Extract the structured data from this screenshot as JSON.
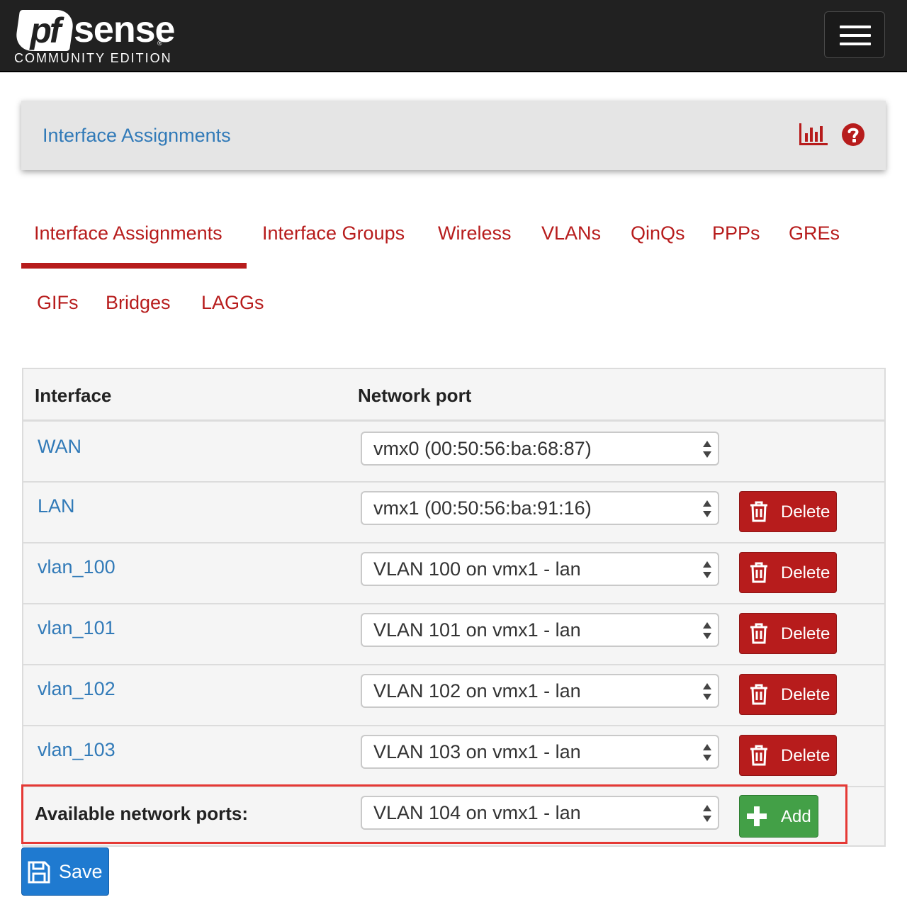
{
  "navbar": {
    "logo_pf": "pf",
    "logo_sense": "sense",
    "logo_reg": "®",
    "logo_edition": "COMMUNITY EDITION"
  },
  "header": {
    "title": "Interface Assignments"
  },
  "tabs": [
    {
      "label": "Interface Assignments",
      "active": true
    },
    {
      "label": "Interface Groups"
    },
    {
      "label": "Wireless"
    },
    {
      "label": "VLANs"
    },
    {
      "label": "QinQs"
    },
    {
      "label": "PPPs"
    },
    {
      "label": "GREs"
    },
    {
      "label": "GIFs"
    },
    {
      "label": "Bridges"
    },
    {
      "label": "LAGGs"
    }
  ],
  "table": {
    "headers": {
      "interface": "Interface",
      "network_port": "Network port"
    },
    "rows": [
      {
        "interface": "WAN",
        "port": "vmx0 (00:50:56:ba:68:87)"
      },
      {
        "interface": "LAN",
        "port": "vmx1 (00:50:56:ba:91:16)",
        "action": "Delete"
      },
      {
        "interface": "vlan_100",
        "port": "VLAN 100 on vmx1 - lan",
        "action": "Delete"
      },
      {
        "interface": "vlan_101",
        "port": "VLAN 101 on vmx1 - lan",
        "action": "Delete"
      },
      {
        "interface": "vlan_102",
        "port": "VLAN 102 on vmx1 - lan",
        "action": "Delete"
      },
      {
        "interface": "vlan_103",
        "port": "VLAN 103 on vmx1 - lan",
        "action": "Delete"
      }
    ],
    "available": {
      "label": "Available network ports:",
      "port": "VLAN 104 on vmx1 - lan",
      "action": "Add"
    }
  },
  "save_label": "Save",
  "colors": {
    "navbar": "#212121",
    "link": "#317ab8",
    "tab": "#b71c1c",
    "delete": "#b71c1c",
    "add": "#43a047",
    "save": "#1f7ad0",
    "highlight": "#e53935"
  }
}
